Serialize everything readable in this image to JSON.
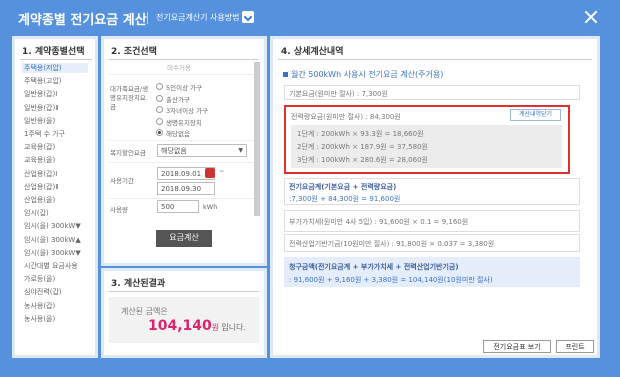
{
  "header": {
    "title": "계약종별 전기요금 계산",
    "link": "전기요금계산기 사용방법"
  },
  "panel1": {
    "title": "1. 계약종별선택",
    "items": [
      "주택용(저압)",
      "주택용(고압)",
      "일반용(갑)Ⅰ",
      "일반용(갑)Ⅱ",
      "일반용(을)",
      "1주택 수 가구",
      "교육용(갑)",
      "교육용(을)",
      "산업용(갑)Ⅰ",
      "산업용(갑)Ⅱ",
      "산업용(을)",
      "임시(갑)",
      "임시(을) 300kW▼",
      "임시(을) 300kW▲",
      "임시(을) 300kW▼",
      "시간대별 요금사용",
      "가로등(을)",
      "심야전력(갑)",
      "농사용(갑)",
      "농사용(을)"
    ]
  },
  "panel2": {
    "title": "2. 조건선택",
    "partial_top": "미수거용",
    "welfare_group_label": "대가족요금/생명유지장치요금",
    "radio_options": [
      "5인이상 가구",
      "출산가구",
      "3자녀이상 가구",
      "생명유지장치",
      "해당없음"
    ],
    "discount_label": "복지할인요금",
    "discount_value": "해당없음",
    "period_label": "사용기간",
    "date_start": "2018.09.01",
    "date_end": "2018.09.30",
    "usage_label": "사용량",
    "usage_value": "500",
    "usage_unit": "kWh",
    "calc_button": "요금계산"
  },
  "panel3": {
    "title": "3. 계산된결과",
    "result_label": "계산된 금액은",
    "amount": "104,140",
    "unit": "원",
    "suffix": "입니다."
  },
  "panel4": {
    "title": "4. 상세계산내역",
    "summary": "월간 500kWh 사용시 전기요금 계산(주거용)",
    "basic": "기본요금(원미만 절사) : 7,300원",
    "energy": "전력량요금(원미만 절사) : 84,300원",
    "detail_button": "계산내역닫기",
    "steps": [
      "1단계 : 200kWh × 93.3원 = 18,660원",
      "2단계 : 200kWh × 187.9원 = 37,580원",
      "3단계 : 100kWh × 280.6원 = 28,060원"
    ],
    "total_label": "전기요금계(기본요금 + 전력량요금)",
    "total_value": ":7,300원 + 84,300원 = 91,600원",
    "vat": "부가가치세(원미만 4사 5입) : 91,600원 × 0.1 = 9,160원",
    "fund": "전력산업기반기금(10원미만 절사) : 91,800원 × 0.037 = 3,380원",
    "claim_label": "청구금액(전기요금계 + 부가가치세 + 전력산업기반기금)",
    "claim_value": ": 91,600원 + 9,160원 + 3,380원 = 104,140원(10원미만 절사)",
    "table_button": "전기요금표 보기",
    "print_button": "프린트"
  }
}
